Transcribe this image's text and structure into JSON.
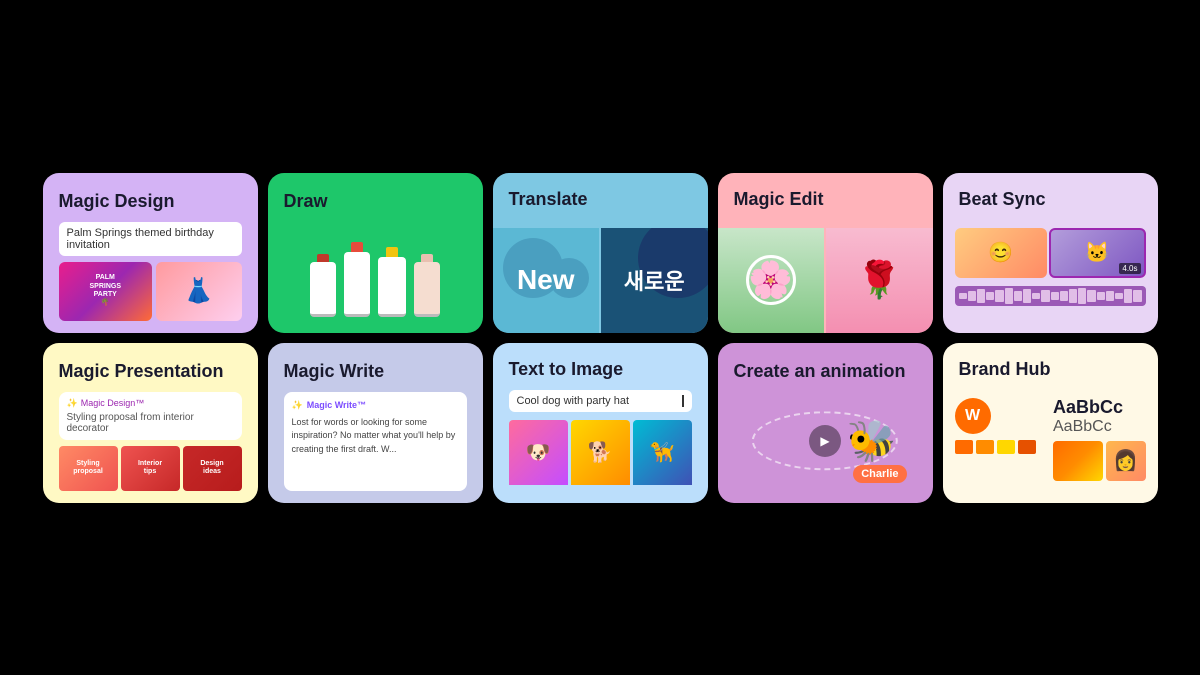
{
  "cards": {
    "magic_design": {
      "title": "Magic Design",
      "input_placeholder": "Palm Springs themed birthday invitation",
      "bg": "#d4b3f5"
    },
    "draw": {
      "title": "Draw",
      "bg": "#1ec76a"
    },
    "translate": {
      "title": "Translate",
      "new_text": "New",
      "korean_text": "새로운",
      "bg": "#7ec8e3"
    },
    "magic_edit": {
      "title": "Magic Edit",
      "bg": "#ffb3ba"
    },
    "beat_sync": {
      "title": "Beat Sync",
      "duration": "4.0s",
      "bg": "#e8d5f5"
    },
    "magic_presentation": {
      "title": "Magic Presentation",
      "badge": "Magic Design™",
      "input_text": "Styling proposal from interior decorator",
      "bg": "#fff9c4"
    },
    "magic_write": {
      "title": "Magic Write",
      "badge": "Magic Write™",
      "body_text": "Lost for words or looking for some inspiration? No matter what you'll help by creating the first draft. W...",
      "bg": "#c5cae9"
    },
    "text_to_image": {
      "title": "Text to Image",
      "input_value": "Cool dog with party hat",
      "bg": "#bbdefb"
    },
    "create_animation": {
      "title": "Create an animation",
      "charlie_label": "Charlie",
      "bg": "#ce93d8"
    },
    "brand_hub": {
      "title": "Brand Hub",
      "font_main": "AaBbCc",
      "font_sub": "AaBbCc",
      "logo_letter": "W",
      "bg": "#fff9e6"
    }
  }
}
